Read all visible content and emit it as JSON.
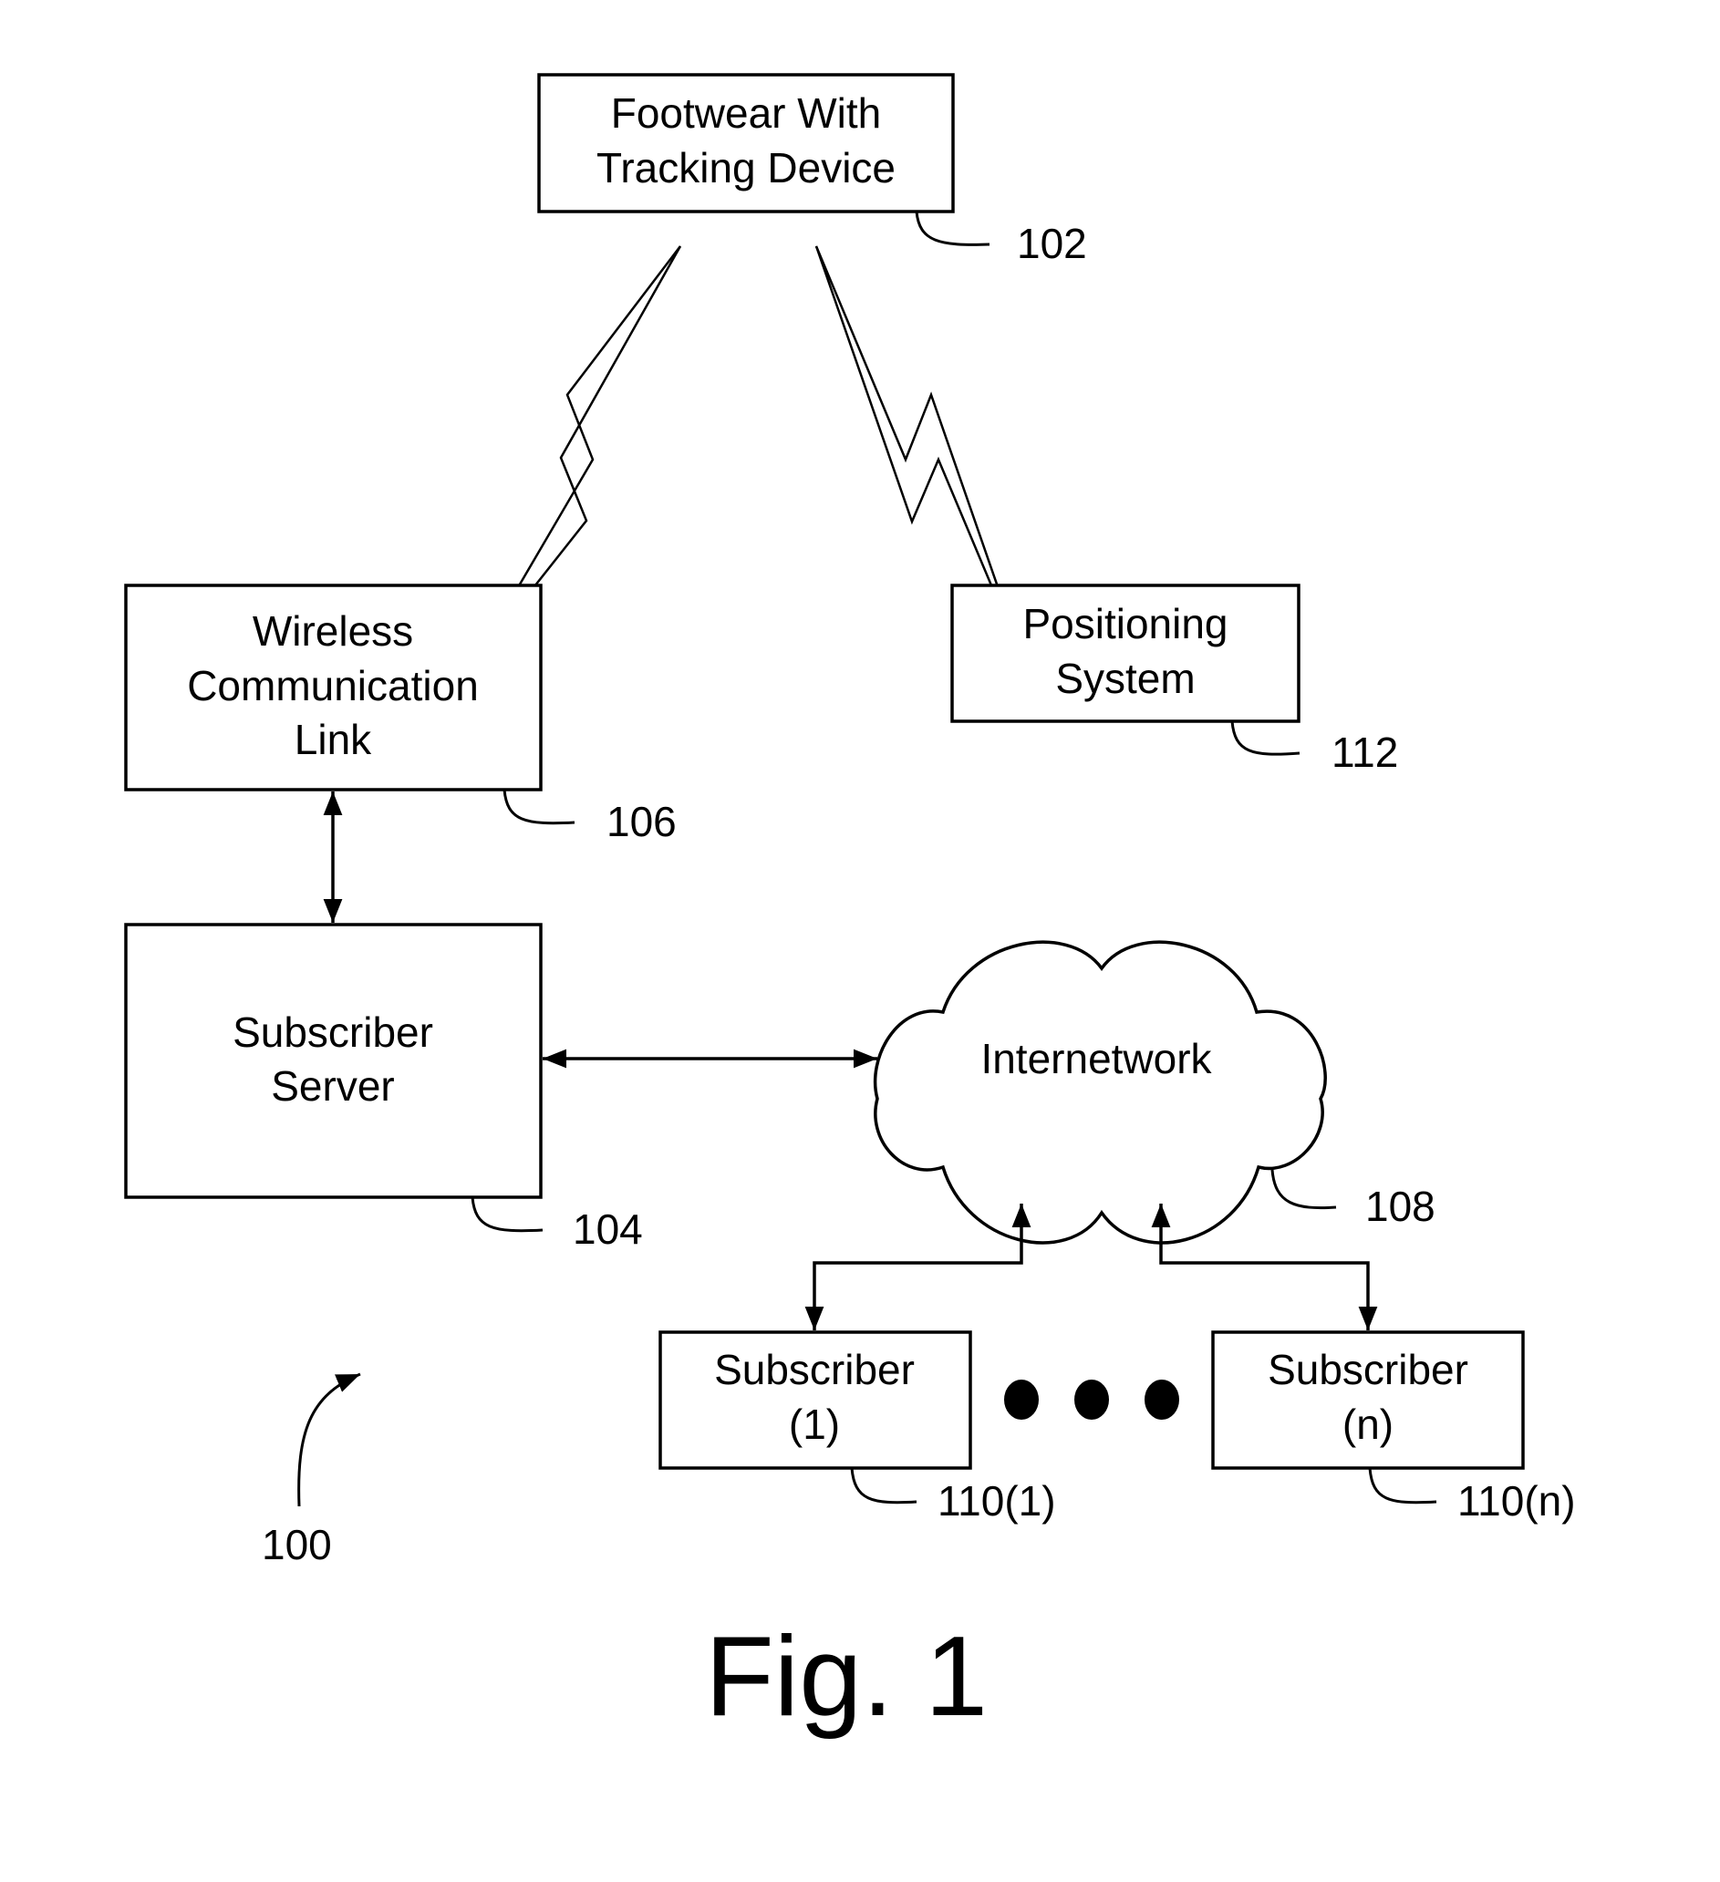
{
  "figure": {
    "caption": "Fig. 1",
    "system_ref": "100"
  },
  "nodes": {
    "footwear": {
      "line1": "Footwear With",
      "line2": "Tracking Device",
      "ref": "102"
    },
    "wireless_link": {
      "line1": "Wireless",
      "line2": "Communication",
      "line3": "Link",
      "ref": "106"
    },
    "positioning": {
      "line1": "Positioning",
      "line2": "System",
      "ref": "112"
    },
    "subscriber_server": {
      "line1": "Subscriber",
      "line2": "Server",
      "ref": "104"
    },
    "internetwork": {
      "label": "Internetwork",
      "ref": "108"
    },
    "subscriber_1": {
      "line1": "Subscriber",
      "line2": "(1)",
      "ref": "110(1)"
    },
    "subscriber_n": {
      "line1": "Subscriber",
      "line2": "(n)",
      "ref": "110(n)"
    }
  },
  "connections": [
    {
      "from": "footwear",
      "to": "wireless_link",
      "type": "wireless"
    },
    {
      "from": "footwear",
      "to": "positioning",
      "type": "wireless"
    },
    {
      "from": "wireless_link",
      "to": "subscriber_server",
      "type": "bidirectional"
    },
    {
      "from": "subscriber_server",
      "to": "internetwork",
      "type": "bidirectional"
    },
    {
      "from": "internetwork",
      "to": "subscriber_1",
      "type": "bidirectional"
    },
    {
      "from": "internetwork",
      "to": "subscriber_n",
      "type": "bidirectional"
    }
  ]
}
